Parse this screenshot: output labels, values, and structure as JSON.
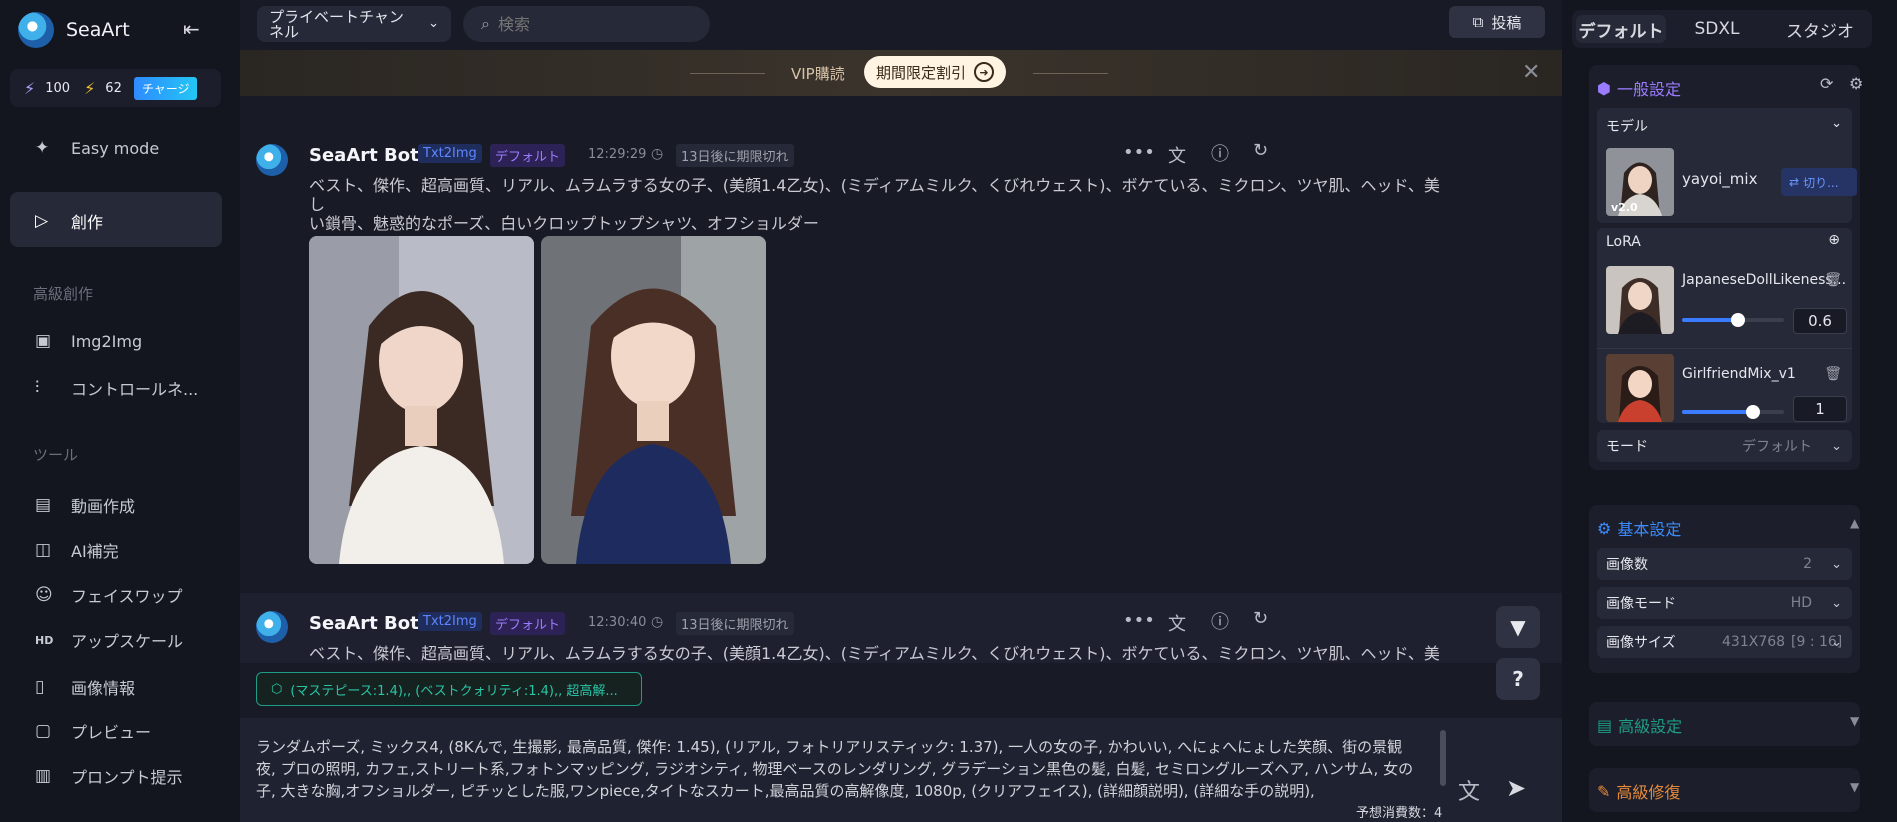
{
  "app": {
    "brand": "SeaArt"
  },
  "credits": {
    "stamina": "100",
    "energy": "62",
    "charge_label": "チャージ"
  },
  "nav": {
    "easy_mode": "Easy mode",
    "create": "創作",
    "advanced_title": "高級創作",
    "img2img": "Img2Img",
    "controlnet": "コントロールネ...",
    "tools_title": "ツール",
    "video": "動画作成",
    "ai_fill": "AI補完",
    "face_swap": "フェイスワップ",
    "upscale": "アップスケール",
    "image_info": "画像情報",
    "preview": "プレビュー",
    "prompt_hint": "プロンプト提示"
  },
  "topbar": {
    "channel_line1": "プライベートチャン",
    "channel_line2": "ネル",
    "search_placeholder": "検索",
    "post_label": "投稿"
  },
  "banner": {
    "vip": "VIP購読",
    "promo": "期間限定割引"
  },
  "messages": [
    {
      "bot": "SeaArt Bot",
      "mode": "Txt2Img",
      "preset": "デフォルト",
      "time": "12:29:29",
      "expire": "13日後に期限切れ",
      "prompt_line1": "ベスト、傑作、超高画質、リアル、ムラムラする女の子、(美顔1.4乙女)、(ミディアムミルク、くびれウェスト)、ボケている、ミクロン、ツヤ肌、ヘッド、美し",
      "prompt_line2": "い鎖骨、魅惑的なポーズ、白いクロップトップシャツ、オフショルダー"
    },
    {
      "bot": "SeaArt Bot",
      "mode": "Txt2Img",
      "preset": "デフォルト",
      "time": "12:30:40",
      "expire": "13日後に期限切れ",
      "prompt_line1": "ベスト、傑作、超高画質、リアル、ムラムラする女の子、(美顔1.4乙女)、(ミディアムミルク、くびれウェスト)、ボケている、ミクロン、ツヤ肌、ヘッド、美し"
    }
  ],
  "chip": "(マステピース:1.4),, (ベストクォリティ:1.4),, 超高解...",
  "composer": {
    "text": "ランダムポーズ, ミックス4, (8Kんで, 生撮影, 最高品質, 傑作: 1.45), (リアル, フォトリアリスティック: 1.37), 一人の女の子, かわいい, へにょへにょした笑顔、街の景観 夜, プロの照明, カフェ,ストリート系,フォトンマッピング, ラジオシティ, 物理ベースのレンダリング, グラデーション黒色の髪, 白髪, セミロングルーズヘア, ハンサム, 女の子, 大きな胸,オフショルダー, ピチッとした服,ワンpiece,タイトなスカート,最高品質の高解像度, 1080p, (クリアフェイス), (詳細顔説明), (詳細な手の説明),",
    "cost": "予想消費数：4"
  },
  "right": {
    "tabs": [
      "デフォルト",
      "SDXL",
      "スタジオ"
    ],
    "general": "一般設定",
    "model_label": "モデル",
    "model_name": "yayoi_mix",
    "model_version": "v2.0",
    "switch_label": "切り...",
    "lora_label": "LoRA",
    "lora": [
      {
        "name": "JapaneseDollLikeness...",
        "weight": "0.6",
        "fraction": 0.55
      },
      {
        "name": "GirlfriendMix_v1",
        "weight": "1",
        "fraction": 0.7
      }
    ],
    "mode_label": "モード",
    "mode_value": "デフォルト",
    "basic": "基本設定",
    "image_count_label": "画像数",
    "image_count": "2",
    "image_mode_label": "画像モード",
    "image_mode": "HD",
    "image_size_label": "画像サイズ",
    "image_size": "431X768",
    "image_ratio": "[9 : 16]",
    "advanced": "高級設定",
    "repair": "高級修復"
  }
}
